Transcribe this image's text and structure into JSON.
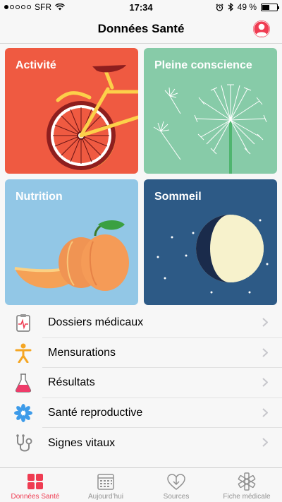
{
  "status_bar": {
    "carrier": "SFR",
    "time": "17:34",
    "battery_text": "49 %",
    "battery_level": 0.49,
    "signal_bars": 1
  },
  "nav": {
    "title": "Données Santé"
  },
  "tiles": [
    {
      "label": "Activité",
      "color": "#ef5a41",
      "icon": "bicycle-illustration"
    },
    {
      "label": "Pleine conscience",
      "color": "#87cba8",
      "icon": "dandelion-illustration"
    },
    {
      "label": "Nutrition",
      "color": "#92c7e6",
      "icon": "peach-illustration"
    },
    {
      "label": "Sommeil",
      "color": "#2d5a86",
      "icon": "moon-illustration"
    }
  ],
  "list": [
    {
      "label": "Dossiers médicaux",
      "icon": "medical-clipboard-icon"
    },
    {
      "label": "Mensurations",
      "icon": "body-figure-icon"
    },
    {
      "label": "Résultats",
      "icon": "flask-icon"
    },
    {
      "label": "Santé reproductive",
      "icon": "flower-icon"
    },
    {
      "label": "Signes vitaux",
      "icon": "stethoscope-icon"
    }
  ],
  "tabs": [
    {
      "label": "Données Santé",
      "icon": "grid-icon",
      "active": true
    },
    {
      "label": "Aujourd’hui",
      "icon": "calendar-icon",
      "active": false
    },
    {
      "label": "Sources",
      "icon": "heart-download-icon",
      "active": false
    },
    {
      "label": "Fiche médicale",
      "icon": "asterisk-icon",
      "active": false
    }
  ],
  "colors": {
    "accent": "#ef3c52",
    "tab_inactive": "#929292"
  }
}
